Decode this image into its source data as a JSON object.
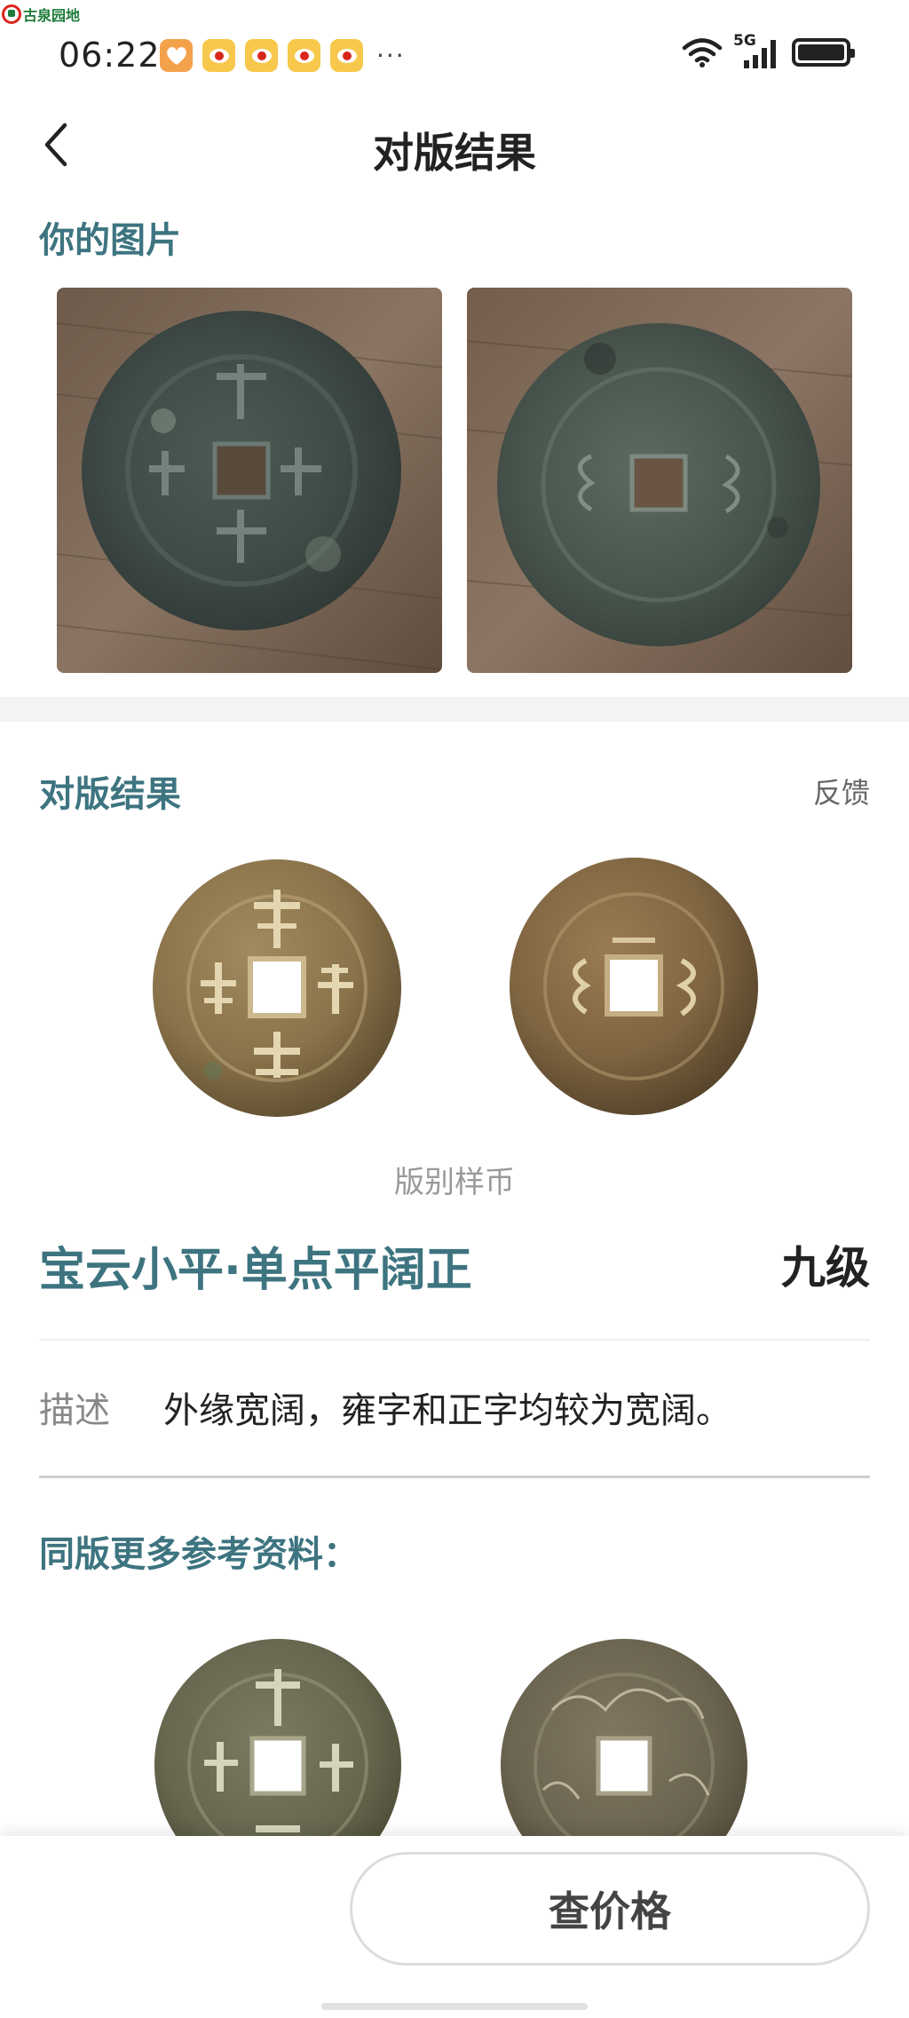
{
  "watermark": {
    "text": "古泉园地"
  },
  "status_bar": {
    "time": "06:22",
    "more": "···",
    "network": "5G",
    "notifications": [
      "heart-app-icon",
      "weibo-icon",
      "weibo-icon",
      "weibo-icon",
      "weibo-icon"
    ]
  },
  "header": {
    "title": "对版结果",
    "back_icon": "chevron-left-icon"
  },
  "your_photos": {
    "heading": "你的图片",
    "photos": [
      "coin-obverse-photo",
      "coin-reverse-photo"
    ]
  },
  "result": {
    "heading": "对版结果",
    "feedback": "反馈",
    "sample_caption": "版别样币",
    "version_name": "宝云小平·单点平阔正",
    "grade": "九级",
    "description_label": "描述",
    "description": "外缘宽阔，雍字和正字均较为宽阔。"
  },
  "more_refs": {
    "heading": "同版更多参考资料："
  },
  "bottom": {
    "check_price": "查价格"
  },
  "colors": {
    "accent": "#3d7480",
    "text": "#222222",
    "muted": "#999999"
  }
}
